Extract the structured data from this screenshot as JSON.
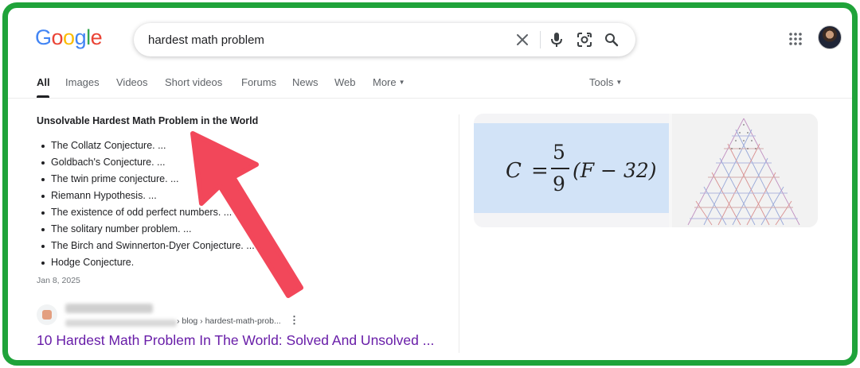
{
  "search": {
    "query": "hardest math problem",
    "placeholder": ""
  },
  "logo": {
    "letters": [
      "G",
      "o",
      "o",
      "g",
      "l",
      "e"
    ]
  },
  "colors": {
    "frame_border": "#1fa33a",
    "link_visited": "#681da8",
    "arrow": "#f2475a",
    "formula_bg": "#d2e3f7",
    "google_blue": "#4285f4",
    "google_red": "#ea4335",
    "google_yellow": "#fbbc05",
    "google_green": "#34a853"
  },
  "icons": {
    "clear": "close-icon",
    "voice": "microphone-icon",
    "lens": "camera-lens-icon",
    "search": "search-icon",
    "apps": "apps-grid-icon"
  },
  "tabs": [
    {
      "label": "All",
      "active": true
    },
    {
      "label": "Images"
    },
    {
      "label": "Videos"
    },
    {
      "label": "Short videos"
    },
    {
      "label": "Forums"
    },
    {
      "label": "News"
    },
    {
      "label": "Web"
    },
    {
      "label": "More"
    }
  ],
  "tools_label": "Tools",
  "snippet": {
    "title": "Unsolvable Hardest Math Problem in the World",
    "items": [
      "The Collatz Conjecture. ...",
      "Goldbach's Conjecture. ...",
      "The twin prime conjecture. ...",
      "Riemann Hypothesis. ...",
      "The existence of odd perfect numbers. ...",
      "The solitary number problem. ...",
      "The Birch and Swinnerton-Dyer Conjecture. ...",
      "Hodge Conjecture."
    ],
    "date": "Jan 8, 2025"
  },
  "result": {
    "breadcrumb": "› blog › hardest-math-prob...",
    "menu_glyph": "⋮",
    "title": "10 Hardest Math Problem In The World: Solved And Unsolved ..."
  },
  "image_panel": {
    "formula": {
      "lhs": "C",
      "eq": "=",
      "numerator": "5",
      "denominator": "9",
      "paren_expr": "(F − 32)"
    }
  }
}
